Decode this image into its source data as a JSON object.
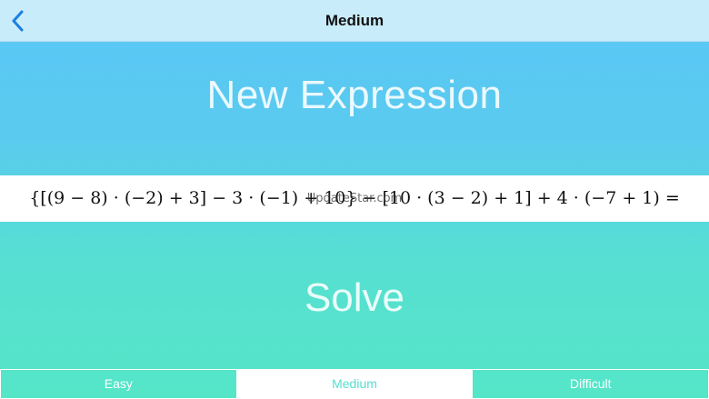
{
  "navbar": {
    "title": "Medium",
    "back_icon": "chevron-left-icon",
    "accent_color": "#1a7fe0"
  },
  "main": {
    "new_expression_label": "New Expression",
    "expression": "{[(9 − 8) · (−2) + 3] − 3 · (−1) + 10} − [10 · (3 − 2) + 1] + 4 · (−7 + 1) =",
    "watermark": "UpdateStar.com",
    "solve_label": "Solve"
  },
  "difficulty": {
    "options": [
      "Easy",
      "Medium",
      "Difficult"
    ],
    "selected": "Medium"
  },
  "colors": {
    "gradient_top": "#5bc6f8",
    "gradient_bottom": "#55e6c8",
    "navbar_bg": "#c9ecfb",
    "selected_segment_text": "#55dfcf"
  }
}
